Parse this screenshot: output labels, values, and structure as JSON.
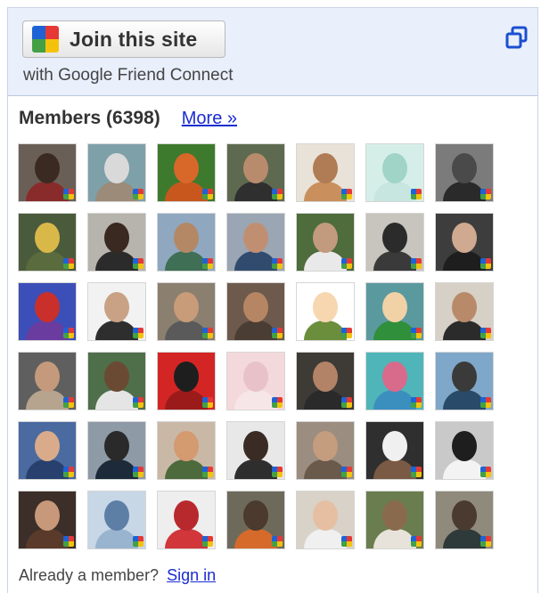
{
  "header": {
    "join_label": "Join this site",
    "with_text": "with Google Friend Connect",
    "logo_icon": "google-friend-connect-logo-icon",
    "popout_icon": "popout-icon"
  },
  "members": {
    "title": "Members (6398)",
    "more_link": "More »"
  },
  "footer": {
    "prompt": "Already a member?",
    "sign_in": "Sign in"
  },
  "colors": {
    "link": "#1a2cd1",
    "header_bg": "#e9effb",
    "badge_red": "#e53935",
    "badge_green": "#43a047",
    "badge_blue": "#1e63d6",
    "badge_yellow": "#f4c20d"
  },
  "member_avatars": [
    {
      "name": "member-1",
      "bg": "#6a5f57",
      "head": "#3b2a22",
      "body": "#8a2b2b"
    },
    {
      "name": "member-2",
      "bg": "#7ea0a8",
      "head": "#d9d9d9",
      "body": "#9b8b78"
    },
    {
      "name": "member-3",
      "bg": "#3e7a2d",
      "head": "#d8672a",
      "body": "#c8571e"
    },
    {
      "name": "member-4",
      "bg": "#5e6a4f",
      "head": "#b98b6d",
      "body": "#2f2f2f"
    },
    {
      "name": "member-5",
      "bg": "#e9e2d8",
      "head": "#b07c55",
      "body": "#c9905e"
    },
    {
      "name": "member-6",
      "bg": "#d6eee8",
      "head": "#9fd4c6",
      "body": "#c6e6df"
    },
    {
      "name": "member-7",
      "bg": "#7b7b7b",
      "head": "#4a4a4a",
      "body": "#2a2a2a"
    },
    {
      "name": "member-8",
      "bg": "#4a5b3c",
      "head": "#d9b84a",
      "body": "#5a6c3d"
    },
    {
      "name": "member-9",
      "bg": "#b7b3ad",
      "head": "#3a2920",
      "body": "#2b2b2b"
    },
    {
      "name": "member-10",
      "bg": "#8fa7bf",
      "head": "#b48765",
      "body": "#3f6f55"
    },
    {
      "name": "member-11",
      "bg": "#9aa6b3",
      "head": "#c08f72",
      "body": "#314b6e"
    },
    {
      "name": "member-12",
      "bg": "#4e6c3c",
      "head": "#c29a7e",
      "body": "#e9e9e9"
    },
    {
      "name": "member-13",
      "bg": "#c8c4be",
      "head": "#2b2b2b",
      "body": "#3a3a3a"
    },
    {
      "name": "member-14",
      "bg": "#3d3d3d",
      "head": "#cfa990",
      "body": "#1e1e1e"
    },
    {
      "name": "member-15",
      "bg": "#3c4fb8",
      "head": "#c9302c",
      "body": "#6a3ca0"
    },
    {
      "name": "member-16",
      "bg": "#f2f2f2",
      "head": "#c9a184",
      "body": "#2e2e2e"
    },
    {
      "name": "member-17",
      "bg": "#8b7f70",
      "head": "#c89b79",
      "body": "#5a5a5a"
    },
    {
      "name": "member-18",
      "bg": "#6e5a4c",
      "head": "#b68664",
      "body": "#4a3d33"
    },
    {
      "name": "member-19",
      "bg": "#ffffff",
      "head": "#f7d7b0",
      "body": "#6b8e3c"
    },
    {
      "name": "member-20",
      "bg": "#5a9a9e",
      "head": "#f1d1a6",
      "body": "#2f8f3a"
    },
    {
      "name": "member-21",
      "bg": "#d7d0c6",
      "head": "#b88a6a",
      "body": "#2b2b2b"
    },
    {
      "name": "member-22",
      "bg": "#5f5f5f",
      "head": "#c59a7c",
      "body": "#b7a48e"
    },
    {
      "name": "member-23",
      "bg": "#4f6e4a",
      "head": "#6b4a34",
      "body": "#e5e5e5"
    },
    {
      "name": "member-24",
      "bg": "#d42525",
      "head": "#1e1e1e",
      "body": "#9b1b1b"
    },
    {
      "name": "member-25",
      "bg": "#f3d9dc",
      "head": "#e8c2c8",
      "body": "#f7e6e8"
    },
    {
      "name": "member-26",
      "bg": "#3e3a36",
      "head": "#b28367",
      "body": "#2a2a2a"
    },
    {
      "name": "member-27",
      "bg": "#4fb5b8",
      "head": "#d86a8c",
      "body": "#3a8fbf"
    },
    {
      "name": "member-28",
      "bg": "#7fa7c9",
      "head": "#3a3a3a",
      "body": "#2a4a6a"
    },
    {
      "name": "member-29",
      "bg": "#4a6aa0",
      "head": "#d9ab8b",
      "body": "#27406d"
    },
    {
      "name": "member-30",
      "bg": "#8e9aa6",
      "head": "#2a2a2a",
      "body": "#1d2a3a"
    },
    {
      "name": "member-31",
      "bg": "#cab8a6",
      "head": "#d49a70",
      "body": "#4d6a3c"
    },
    {
      "name": "member-32",
      "bg": "#e8e8e8",
      "head": "#3a2c24",
      "body": "#2e2e2e"
    },
    {
      "name": "member-33",
      "bg": "#9b8d80",
      "head": "#c49c7e",
      "body": "#6a5a4c"
    },
    {
      "name": "member-34",
      "bg": "#2f2f2f",
      "head": "#f0f0f0",
      "body": "#7a5a45"
    },
    {
      "name": "member-35",
      "bg": "#c9c9c9",
      "head": "#1e1e1e",
      "body": "#f3f3f3"
    },
    {
      "name": "member-36",
      "bg": "#3c2e28",
      "head": "#c7987a",
      "body": "#5a3b2b"
    },
    {
      "name": "member-37",
      "bg": "#c7d7e6",
      "head": "#5e7fa5",
      "body": "#99b4cf"
    },
    {
      "name": "member-38",
      "bg": "#eeeeee",
      "head": "#b8292d",
      "body": "#d1363a"
    },
    {
      "name": "member-39",
      "bg": "#6d6a5c",
      "head": "#4b3a2d",
      "body": "#d66a2a"
    },
    {
      "name": "member-40",
      "bg": "#d8d2c8",
      "head": "#e6bfa2",
      "body": "#f0f0f0"
    },
    {
      "name": "member-41",
      "bg": "#6a7d4f",
      "head": "#8a6a4d",
      "body": "#e8e3da"
    },
    {
      "name": "member-42",
      "bg": "#8f8a7c",
      "head": "#4a3a30",
      "body": "#2e3a3a"
    }
  ]
}
